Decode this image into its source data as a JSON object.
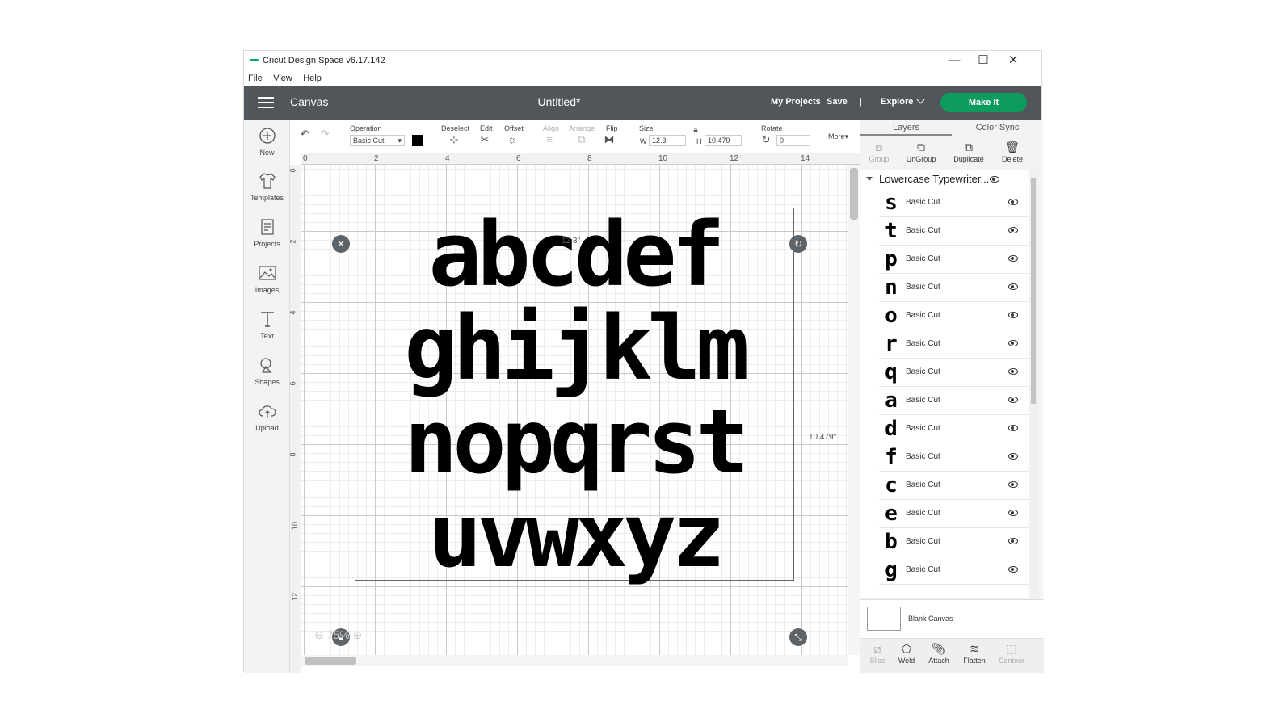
{
  "window": {
    "title": "Cricut Design Space  v6.17.142",
    "controls": {
      "minimize": "—",
      "maximize": "☐",
      "close": "✕"
    }
  },
  "menu": [
    "File",
    "View",
    "Help"
  ],
  "header": {
    "section_title": "Canvas",
    "document_title": "Untitled*",
    "my_projects": "My Projects",
    "save": "Save",
    "divider": "|",
    "explore": "Explore",
    "make_it": "Make It",
    "accent_color": "#0e9c5e",
    "bar_color": "#51565b"
  },
  "left_sidebar": [
    {
      "label": "New",
      "icon": "plus-circle-icon"
    },
    {
      "label": "Templates",
      "icon": "tshirt-icon"
    },
    {
      "label": "Projects",
      "icon": "projects-icon"
    },
    {
      "label": "Images",
      "icon": "image-icon"
    },
    {
      "label": "Text",
      "icon": "text-icon"
    },
    {
      "label": "Shapes",
      "icon": "shapes-icon"
    },
    {
      "label": "Upload",
      "icon": "cloud-upload-icon"
    }
  ],
  "toolbar": {
    "operation_label": "Operation",
    "operation_value": "Basic Cut",
    "color_swatch": "#000000",
    "deselect": "Deselect",
    "edit": "Edit",
    "offset": "Offset",
    "align": "Align",
    "arrange": "Arrange",
    "flip": "Flip",
    "size_label": "Size",
    "w_label": "W",
    "w_value": "12.3",
    "h_label": "H",
    "h_value": "10.479",
    "rotate_label": "Rotate",
    "rotate_value": "0",
    "more": "More"
  },
  "canvas": {
    "ruler_top": [
      "0",
      "2",
      "4",
      "6",
      "8",
      "10",
      "12",
      "14"
    ],
    "ruler_left": [
      "0",
      "2",
      "4",
      "6",
      "8",
      "10",
      "12"
    ],
    "width_dim": "12.3\"",
    "height_dim": "10.479\"",
    "zoom": "75%",
    "text_lines": [
      "abcdef",
      "ghijklm",
      "nopqrst",
      "uvwxyz"
    ]
  },
  "right_panel": {
    "tabs": [
      "Layers",
      "Color Sync"
    ],
    "actions": [
      {
        "label": "Group",
        "icon": "group-icon",
        "enabled": false
      },
      {
        "label": "UnGroup",
        "icon": "ungroup-icon",
        "enabled": true
      },
      {
        "label": "Duplicate",
        "icon": "duplicate-icon",
        "enabled": true
      },
      {
        "label": "Delete",
        "icon": "trash-icon",
        "enabled": true
      }
    ],
    "group_name": "Lowercase Typewriter...",
    "layers": [
      {
        "glyph": "s",
        "name": "Basic Cut"
      },
      {
        "glyph": "t",
        "name": "Basic Cut"
      },
      {
        "glyph": "p",
        "name": "Basic Cut"
      },
      {
        "glyph": "n",
        "name": "Basic Cut"
      },
      {
        "glyph": "o",
        "name": "Basic Cut"
      },
      {
        "glyph": "r",
        "name": "Basic Cut"
      },
      {
        "glyph": "q",
        "name": "Basic Cut"
      },
      {
        "glyph": "a",
        "name": "Basic Cut"
      },
      {
        "glyph": "d",
        "name": "Basic Cut"
      },
      {
        "glyph": "f",
        "name": "Basic Cut"
      },
      {
        "glyph": "c",
        "name": "Basic Cut"
      },
      {
        "glyph": "e",
        "name": "Basic Cut"
      },
      {
        "glyph": "b",
        "name": "Basic Cut"
      },
      {
        "glyph": "g",
        "name": "Basic Cut"
      }
    ],
    "blank_canvas": "Blank Canvas",
    "bottom_actions": [
      {
        "label": "Slice",
        "icon": "slice-icon",
        "enabled": false
      },
      {
        "label": "Weld",
        "icon": "weld-icon",
        "enabled": true
      },
      {
        "label": "Attach",
        "icon": "attach-icon",
        "enabled": true
      },
      {
        "label": "Flatten",
        "icon": "flatten-icon",
        "enabled": true
      },
      {
        "label": "Contour",
        "icon": "contour-icon",
        "enabled": false
      }
    ]
  }
}
